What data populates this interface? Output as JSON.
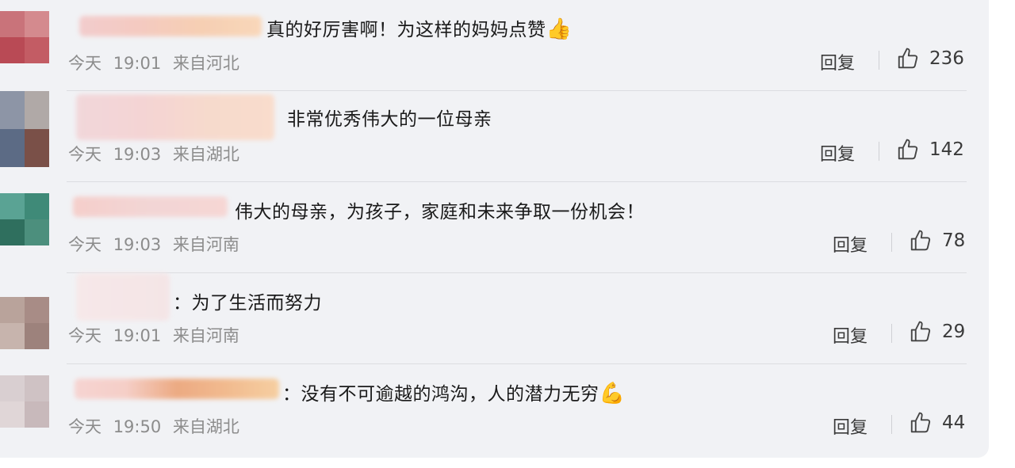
{
  "comments": [
    {
      "text": "真的好厉害啊！为这样的妈妈点赞",
      "emoji": "👍",
      "day": "今天",
      "time": "19:01",
      "location": "来自河北",
      "reply_label": "回复",
      "likes": "236",
      "avatar_colors": [
        "#c9737a",
        "#d48a8e",
        "#b94a55",
        "#c35c64"
      ]
    },
    {
      "text": "非常优秀伟大的一位母亲",
      "emoji": "",
      "day": "今天",
      "time": "19:03",
      "location": "来自湖北",
      "reply_label": "回复",
      "likes": "142",
      "avatar_colors": [
        "#8d95a6",
        "#b0a9a7",
        "#5c6b85",
        "#7a5048"
      ]
    },
    {
      "text": "伟大的母亲，为孩子，家庭和未来争取一份机会！",
      "emoji": "",
      "day": "今天",
      "time": "19:03",
      "location": "来自河南",
      "reply_label": "回复",
      "likes": "78",
      "avatar_colors": [
        "#5aa394",
        "#3f8a78",
        "#2f6f5e",
        "#4c8f7d"
      ]
    },
    {
      "text": "：为了生活而努力",
      "emoji": "",
      "day": "今天",
      "time": "19:01",
      "location": "来自河南",
      "reply_label": "回复",
      "likes": "29",
      "avatar_colors": [
        "#b9a39b",
        "#a88c86",
        "#c7b4ad",
        "#9d827c"
      ]
    },
    {
      "text": "：没有不可逾越的鸿沟，人的潜力无穷",
      "emoji": "💪",
      "day": "今天",
      "time": "19:50",
      "location": "来自湖北",
      "reply_label": "回复",
      "likes": "44",
      "avatar_colors": [
        "#d9cfd1",
        "#cfc2c4",
        "#e0d6d7",
        "#c8b9bb"
      ]
    }
  ]
}
